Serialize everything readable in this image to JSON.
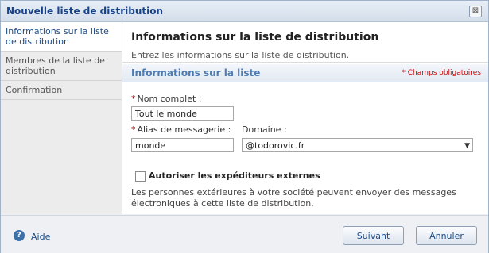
{
  "window": {
    "title": "Nouvelle liste de distribution",
    "close_glyph": "⊠"
  },
  "sidebar": {
    "items": [
      {
        "label": "Informations sur la liste de distribution",
        "active": true
      },
      {
        "label": "Membres de la liste de distribution",
        "active": false
      },
      {
        "label": "Confirmation",
        "active": false
      }
    ]
  },
  "main": {
    "title": "Informations sur la liste de distribution",
    "description": "Entrez les informations sur la liste de distribution.",
    "section_title": "Informations sur la liste",
    "required_note": "* Champs obligatoires",
    "required_star": "*",
    "full_name": {
      "label": "Nom complet :",
      "value": "Tout le monde"
    },
    "alias": {
      "label": "Alias de messagerie :",
      "value": "monde"
    },
    "domain": {
      "label": "Domaine :",
      "value": "@todorovic.fr",
      "arrow": "▼"
    },
    "external_senders": {
      "label": "Autoriser les expéditeurs externes",
      "checked": false,
      "description": "Les personnes extérieures à votre société peuvent envoyer des messages électroniques à cette liste de distribution."
    }
  },
  "footer": {
    "help_glyph": "?",
    "help_label": "Aide",
    "next_label": "Suivant",
    "cancel_label": "Annuler"
  },
  "colors": {
    "accent": "#1b4d8c",
    "required": "#cc0000",
    "section": "#4d7bb3"
  }
}
